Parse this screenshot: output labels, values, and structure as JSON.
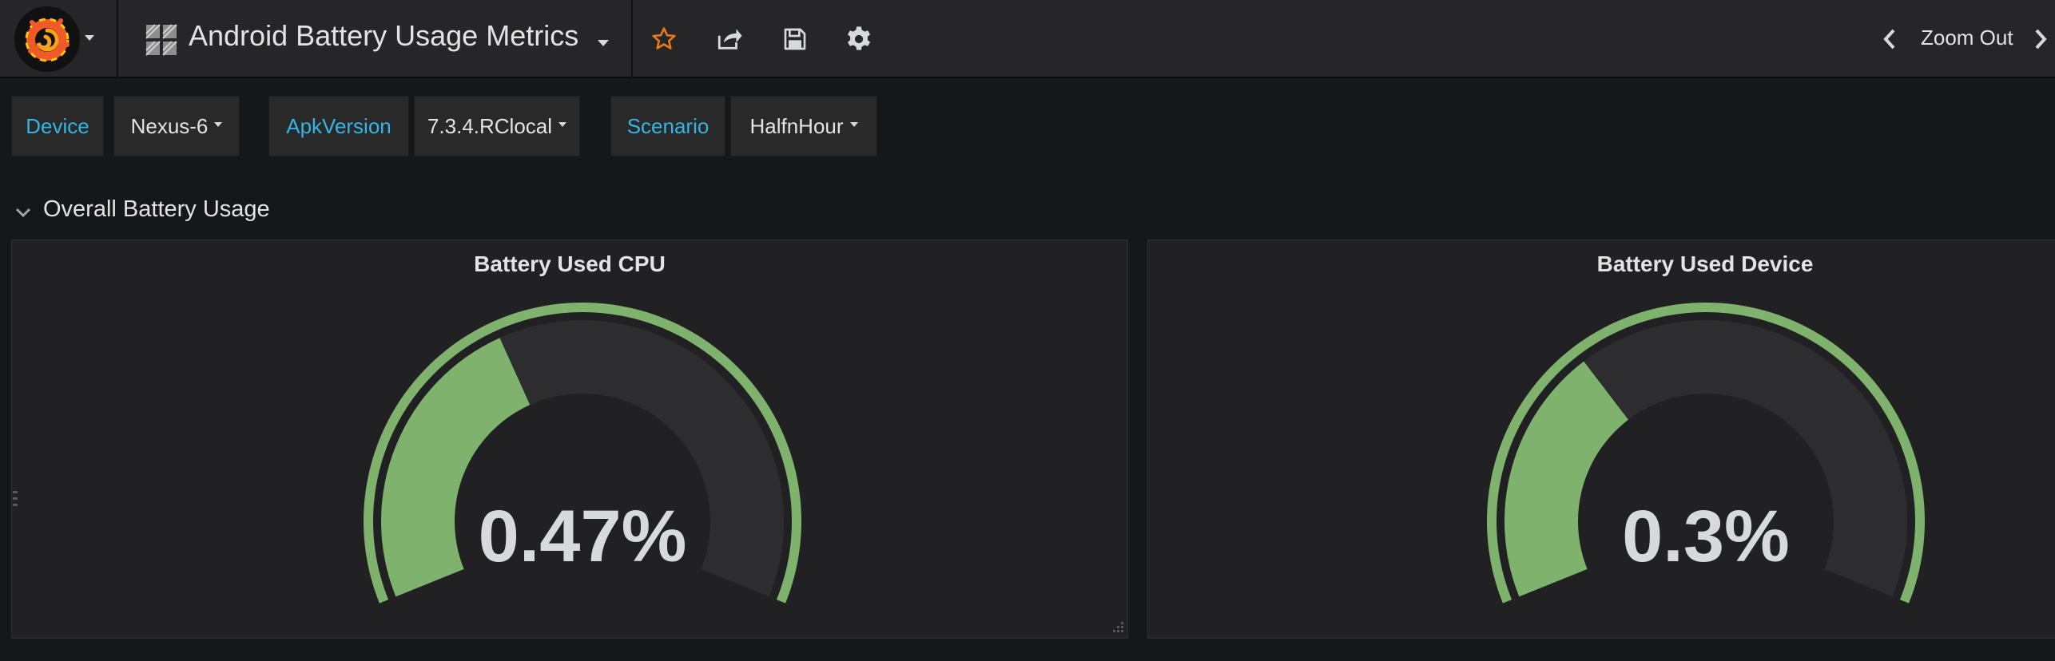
{
  "navbar": {
    "dashboard_title": "Android Battery Usage Metrics",
    "logo_icon": "grafana-logo-icon",
    "dashboard_icon": "dashboard-grid-icon",
    "buttons": [
      {
        "name": "star-icon",
        "color": "#eb7b18"
      },
      {
        "name": "share-icon",
        "color": "#d8d9da"
      },
      {
        "name": "save-icon",
        "color": "#d8d9da"
      },
      {
        "name": "gear-icon",
        "color": "#d8d9da"
      }
    ],
    "zoom_out_label": "Zoom Out"
  },
  "variables": [
    {
      "label": "Device",
      "value": "Nexus-6"
    },
    {
      "label": "ApkVersion",
      "value": "7.3.4.RClocal"
    },
    {
      "label": "Scenario",
      "value": "HalfnHour"
    }
  ],
  "row": {
    "title": "Overall Battery Usage"
  },
  "panels": [
    {
      "title": "Battery Used CPU",
      "value_text": "0.47%",
      "value": 0.47,
      "max": 1.2
    },
    {
      "title": "Battery Used Device",
      "value_text": "0.3%",
      "value": 0.3,
      "max": 0.9
    }
  ],
  "colors": {
    "accent_blue": "#33b5e5",
    "gauge_green": "#7eb26d",
    "gauge_track": "#2d2d30",
    "star_orange": "#eb7b18"
  }
}
